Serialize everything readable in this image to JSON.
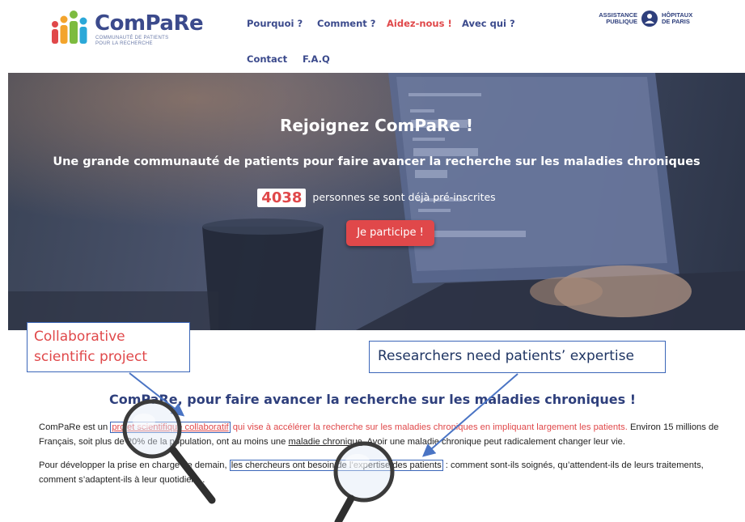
{
  "header": {
    "logo_name": "ComPaRe",
    "logo_tagline_1": "COMMUNAUTÉ DE PATIENTS",
    "logo_tagline_2": "POUR LA RECHERCHE",
    "nav": [
      {
        "label": "Pourquoi ?"
      },
      {
        "label": "Comment ?"
      },
      {
        "label": "Aidez-nous !"
      },
      {
        "label": "Avec qui ?"
      },
      {
        "label": "Contact"
      },
      {
        "label": "F.A.Q"
      }
    ],
    "partner": {
      "line1": "ASSISTANCE",
      "line2": "PUBLIQUE",
      "line3": "HÔPITAUX",
      "line4": "DE PARIS"
    }
  },
  "hero": {
    "title": "Rejoignez ComPaRe !",
    "subtitle": "Une grande communauté de patients pour faire avancer la recherche sur les maladies chroniques",
    "count": "4038",
    "count_text": "personnes se sont déjà pré-inscrites",
    "cta_label": "Je participe !"
  },
  "callouts": {
    "left_line1": "Collaborative",
    "left_line2": "scientific project",
    "right": "Researchers need patients’ expertise"
  },
  "content": {
    "title": "ComPaRe, pour faire avancer la recherche sur les maladies chroniques !",
    "p1_a": "ComPaRe est un ",
    "p1_link": "projet scientifique collaboratif",
    "p1_b": " qui vise à accélérer la recherche sur les maladies chroniques en impliquant largement les patients.",
    "p1_c": " Environ 15 millions de Français, soit plus de 20% de la population, ont au moins une ",
    "p1_link2": "maladie chronique",
    "p1_d": ". Avoir une maladie chronique peut radicalement changer leur vie.",
    "p2_a": "Pour développer la prise en charge de demain, ",
    "p2_boxed": "les chercheurs ont besoin de l’expertise des patients",
    "p2_b": " : comment sont-ils soignés, qu’attendent-ils de leurs traitements, comment s’adaptent-ils à leur quotidien…"
  },
  "colors": {
    "brand_blue": "#3b4a8c",
    "accent_red": "#e0484a",
    "callout_border": "#3b66b8"
  }
}
